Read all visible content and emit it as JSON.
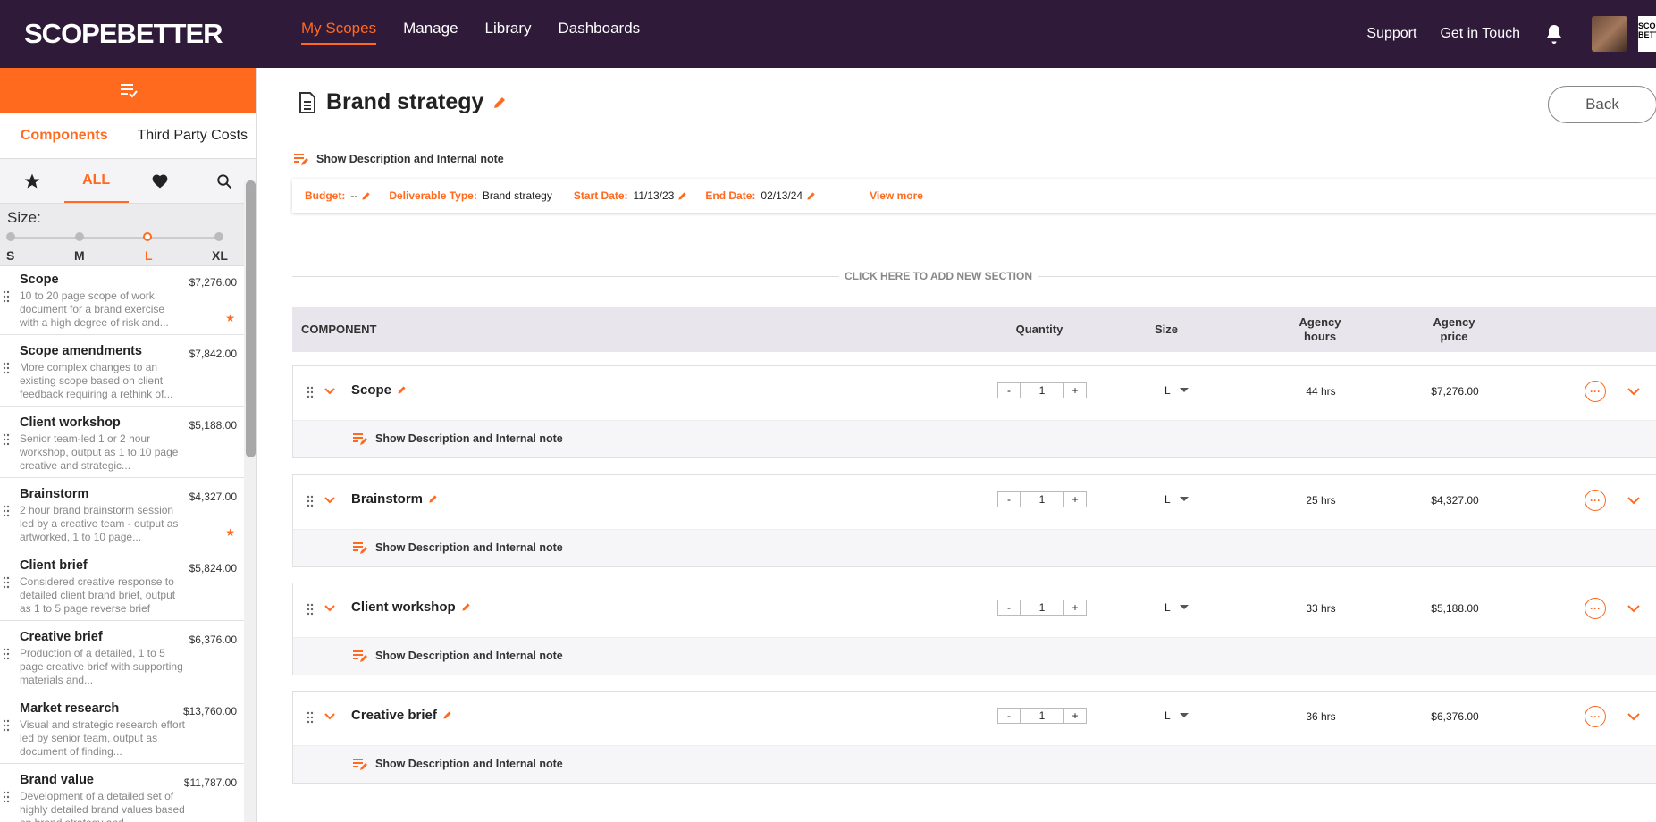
{
  "nav": {
    "logo": "SCOPEBETTER",
    "links": [
      "My Scopes",
      "Manage",
      "Library",
      "Dashboards"
    ],
    "support": "Support",
    "contact": "Get in Touch",
    "avatar_edge_text": "SCO BETT"
  },
  "sidebar": {
    "tabs": [
      "Components",
      "Third Party Costs"
    ],
    "filter_all": "ALL",
    "size_label": "Size:",
    "sizes": [
      "S",
      "M",
      "L",
      "XL"
    ],
    "selected_size": "L",
    "components": [
      {
        "name": "Scope",
        "desc": "10 to 20 page scope of work document for a brand exercise with a high degree of risk and...",
        "price": "$7,276.00",
        "starred": true
      },
      {
        "name": "Scope amendments",
        "desc": "More complex changes to an existing scope based on client feedback requiring a rethink of...",
        "price": "$7,842.00",
        "starred": false
      },
      {
        "name": "Client workshop",
        "desc": "Senior team-led 1 or 2 hour workshop, output as 1 to 10 page creative and strategic...",
        "price": "$5,188.00",
        "starred": false
      },
      {
        "name": "Brainstorm",
        "desc": "2 hour brand brainstorm session led by a creative team - output as artworked, 1 to 10 page...",
        "price": "$4,327.00",
        "starred": true
      },
      {
        "name": "Client brief",
        "desc": "Considered creative response to detailed client brand brief, output as 1 to 5 page reverse brief",
        "price": "$5,824.00",
        "starred": false
      },
      {
        "name": "Creative brief",
        "desc": "Production of a detailed, 1 to 5 page creative brief with supporting materials and...",
        "price": "$6,376.00",
        "starred": false
      },
      {
        "name": "Market research",
        "desc": "Visual and strategic research effort led by senior team, output as document of finding...",
        "price": "$13,760.00",
        "starred": false
      },
      {
        "name": "Brand value",
        "desc": "Development of a detailed set of highly detailed brand values based on brand strategy and...",
        "price": "$11,787.00",
        "starred": false
      }
    ]
  },
  "main": {
    "title": "Brand strategy",
    "back": "Back",
    "show_desc": "Show Description and Internal note",
    "meta": {
      "budget_label": "Budget:",
      "budget": "--",
      "type_label": "Deliverable Type:",
      "type": "Brand strategy",
      "start_label": "Start Date:",
      "start": "11/13/23",
      "end_label": "End Date:",
      "end": "02/13/24",
      "view_more": "View more"
    },
    "add_section": "CLICK HERE TO ADD NEW SECTION",
    "table": {
      "headers": {
        "component": "COMPONENT",
        "quantity": "Quantity",
        "size": "Size",
        "hours": "Agency hours",
        "price": "Agency price"
      },
      "rows": [
        {
          "name": "Scope",
          "qty": "1",
          "size": "L",
          "hours": "44 hrs",
          "price": "$7,276.00"
        },
        {
          "name": "Brainstorm",
          "qty": "1",
          "size": "L",
          "hours": "25 hrs",
          "price": "$4,327.00"
        },
        {
          "name": "Client workshop",
          "qty": "1",
          "size": "L",
          "hours": "33 hrs",
          "price": "$5,188.00"
        },
        {
          "name": "Creative brief",
          "qty": "1",
          "size": "L",
          "hours": "36 hrs",
          "price": "$6,376.00"
        }
      ]
    }
  },
  "colors": {
    "accent": "#ff6a1f",
    "nav_bg": "#2f1a3a"
  }
}
